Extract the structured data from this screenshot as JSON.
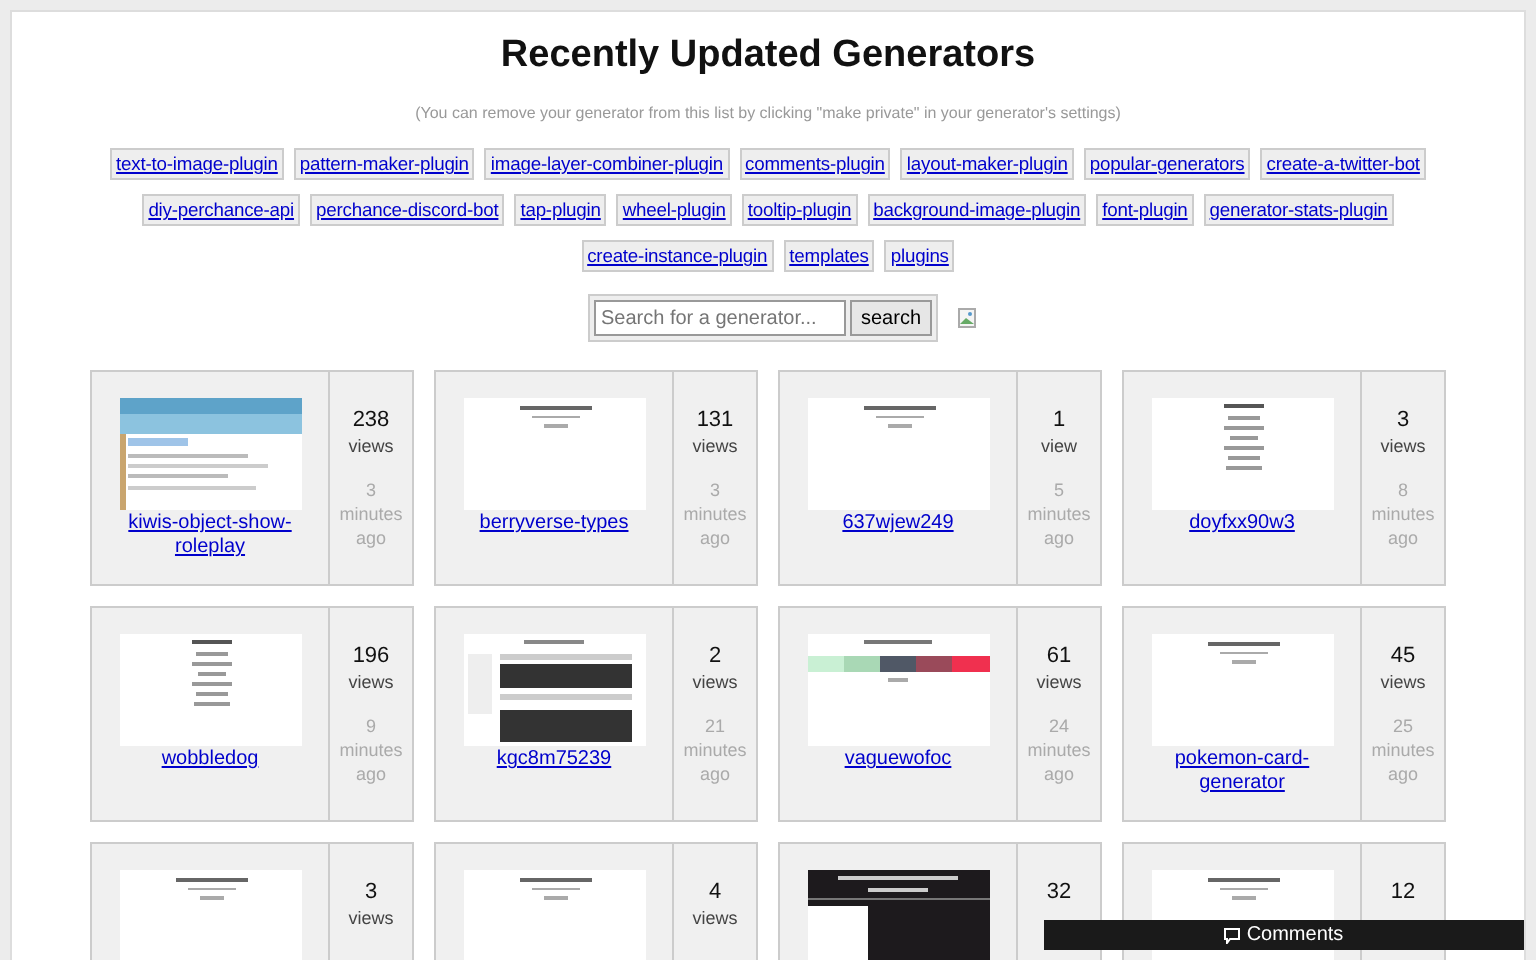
{
  "title": "Recently Updated Generators",
  "note": "(You can remove your generator from this list by clicking \"make private\" in your generator's settings)",
  "tags": [
    "text-to-image-plugin",
    "pattern-maker-plugin",
    "image-layer-combiner-plugin",
    "comments-plugin",
    "layout-maker-plugin",
    "popular-generators",
    "create-a-twitter-bot",
    "diy-perchance-api",
    "perchance-discord-bot",
    "tap-plugin",
    "wheel-plugin",
    "tooltip-plugin",
    "background-image-plugin",
    "font-plugin",
    "generator-stats-plugin",
    "create-instance-plugin",
    "templates",
    "plugins"
  ],
  "search": {
    "placeholder": "Search for a generator...",
    "button": "search"
  },
  "generators": [
    {
      "name": "kiwis-object-show-roleplay",
      "views": "238",
      "views_label": "views",
      "age": "3 minutes ago"
    },
    {
      "name": "berryverse-types",
      "views": "131",
      "views_label": "views",
      "age": "3 minutes ago"
    },
    {
      "name": "637wjew249",
      "views": "1",
      "views_label": "view",
      "age": "5 minutes ago"
    },
    {
      "name": "doyfxx90w3",
      "views": "3",
      "views_label": "views",
      "age": "8 minutes ago"
    },
    {
      "name": "wobbledog",
      "views": "196",
      "views_label": "views",
      "age": "9 minutes ago"
    },
    {
      "name": "kgc8m75239",
      "views": "2",
      "views_label": "views",
      "age": "21 minutes ago"
    },
    {
      "name": "vaguewofoc",
      "views": "61",
      "views_label": "views",
      "age": "24 minutes ago"
    },
    {
      "name": "pokemon-card-generator",
      "views": "45",
      "views_label": "views",
      "age": "25 minutes ago"
    },
    {
      "views": "3",
      "views_label": "views"
    },
    {
      "views": "4",
      "views_label": "views"
    },
    {
      "views": "32"
    },
    {
      "views": "12"
    }
  ],
  "comments_bar": {
    "label": "Comments"
  }
}
